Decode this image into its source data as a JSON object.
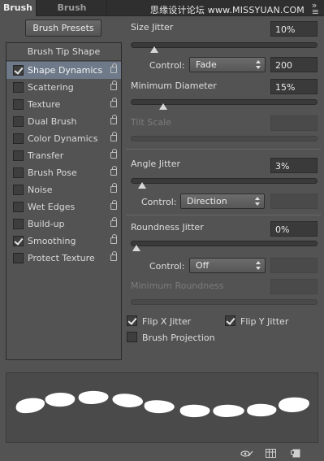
{
  "tabs": {
    "active": "Brush",
    "inactive": "Brush Presets"
  },
  "watermark": "思缘设计论坛 www.MISSYUAN.COM",
  "presets_button": "Brush Presets",
  "left_list": {
    "header": "Brush Tip Shape",
    "items": [
      {
        "label": "Shape Dynamics",
        "checked": true,
        "selected": true
      },
      {
        "label": "Scattering",
        "checked": false
      },
      {
        "label": "Texture",
        "checked": false
      },
      {
        "label": "Dual Brush",
        "checked": false
      },
      {
        "label": "Color Dynamics",
        "checked": false
      },
      {
        "label": "Transfer",
        "checked": false
      },
      {
        "label": "Brush Pose",
        "checked": false
      },
      {
        "label": "Noise",
        "checked": false
      },
      {
        "label": "Wet Edges",
        "checked": false
      },
      {
        "label": "Build-up",
        "checked": false
      },
      {
        "label": "Smoothing",
        "checked": true
      },
      {
        "label": "Protect Texture",
        "checked": false
      }
    ]
  },
  "size_jitter": {
    "label": "Size Jitter",
    "value": "10%",
    "level": 0.1
  },
  "control1": {
    "label": "Control:",
    "selected": "Fade",
    "value": "200"
  },
  "min_diameter": {
    "label": "Minimum Diameter",
    "value": "15%",
    "level": 0.15
  },
  "tilt_scale": {
    "label": "Tilt Scale"
  },
  "angle_jitter": {
    "label": "Angle Jitter",
    "value": "3%",
    "level": 0.03
  },
  "control2": {
    "label": "Control:",
    "selected": "Direction"
  },
  "roundness_jitter": {
    "label": "Roundness Jitter",
    "value": "0%",
    "level": 0.0
  },
  "control3": {
    "label": "Control:",
    "selected": "Off"
  },
  "min_roundness": {
    "label": "Minimum Roundness"
  },
  "flip_x": {
    "label": "Flip X Jitter",
    "checked": true
  },
  "flip_y": {
    "label": "Flip Y Jitter",
    "checked": true
  },
  "brush_projection": {
    "label": "Brush Projection",
    "checked": false
  },
  "icons": [
    "eye-toggle-icon",
    "grid-icon",
    "new-preset-icon"
  ],
  "colors": {
    "panel": "#535353",
    "selected_row": "#6e7a8a",
    "field": "#3a3a3a"
  }
}
